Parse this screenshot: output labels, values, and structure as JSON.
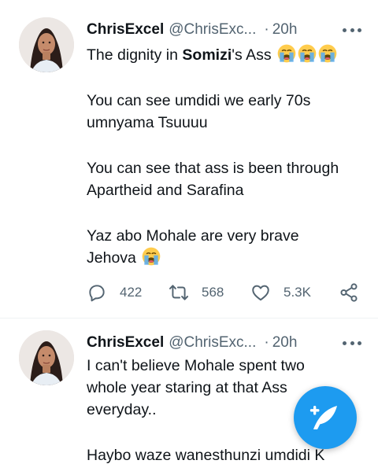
{
  "tweets": [
    {
      "author": {
        "name": "ChrisExcel",
        "handle": "@ChrisExc...",
        "separator": "·",
        "time": "20h"
      },
      "lines": [
        {
          "pre": "The dignity in ",
          "bold": "Somizi",
          "post": "'s Ass",
          "emoji_count": 3
        },
        {
          "text": "You can see umdidi we early 70s"
        },
        {
          "text": "umnyama Tsuuuu"
        },
        {
          "text": "You can see that ass is been through"
        },
        {
          "text": "Apartheid and Sarafina"
        },
        {
          "text": "Yaz abo Mohale are very brave"
        },
        {
          "text": "Jehova",
          "emoji_count": 1
        }
      ],
      "stats": {
        "replies": "422",
        "retweets": "568",
        "likes": "5.3K"
      }
    },
    {
      "author": {
        "name": "ChrisExcel",
        "handle": "@ChrisExc...",
        "separator": "·",
        "time": "20h"
      },
      "lines": [
        {
          "text": "I can't believe Mohale spent two"
        },
        {
          "text": "whole year staring at that Ass"
        },
        {
          "text": "everyday.."
        },
        {
          "text": "Haybo waze wanesthunzi umdidi K"
        }
      ]
    }
  ],
  "icons": {
    "reply": "reply-icon",
    "retweet": "retweet-icon",
    "like": "heart-icon",
    "share": "share-icon",
    "more": "more-icon",
    "compose": "compose-tweet-icon",
    "emoji": "loudly-crying-face-emoji"
  },
  "colors": {
    "accent": "#1d9bf0",
    "text": "#0f1419",
    "secondary": "#536471",
    "emoji_face": "#ffcc4d",
    "emoji_tears": "#5dadec"
  }
}
